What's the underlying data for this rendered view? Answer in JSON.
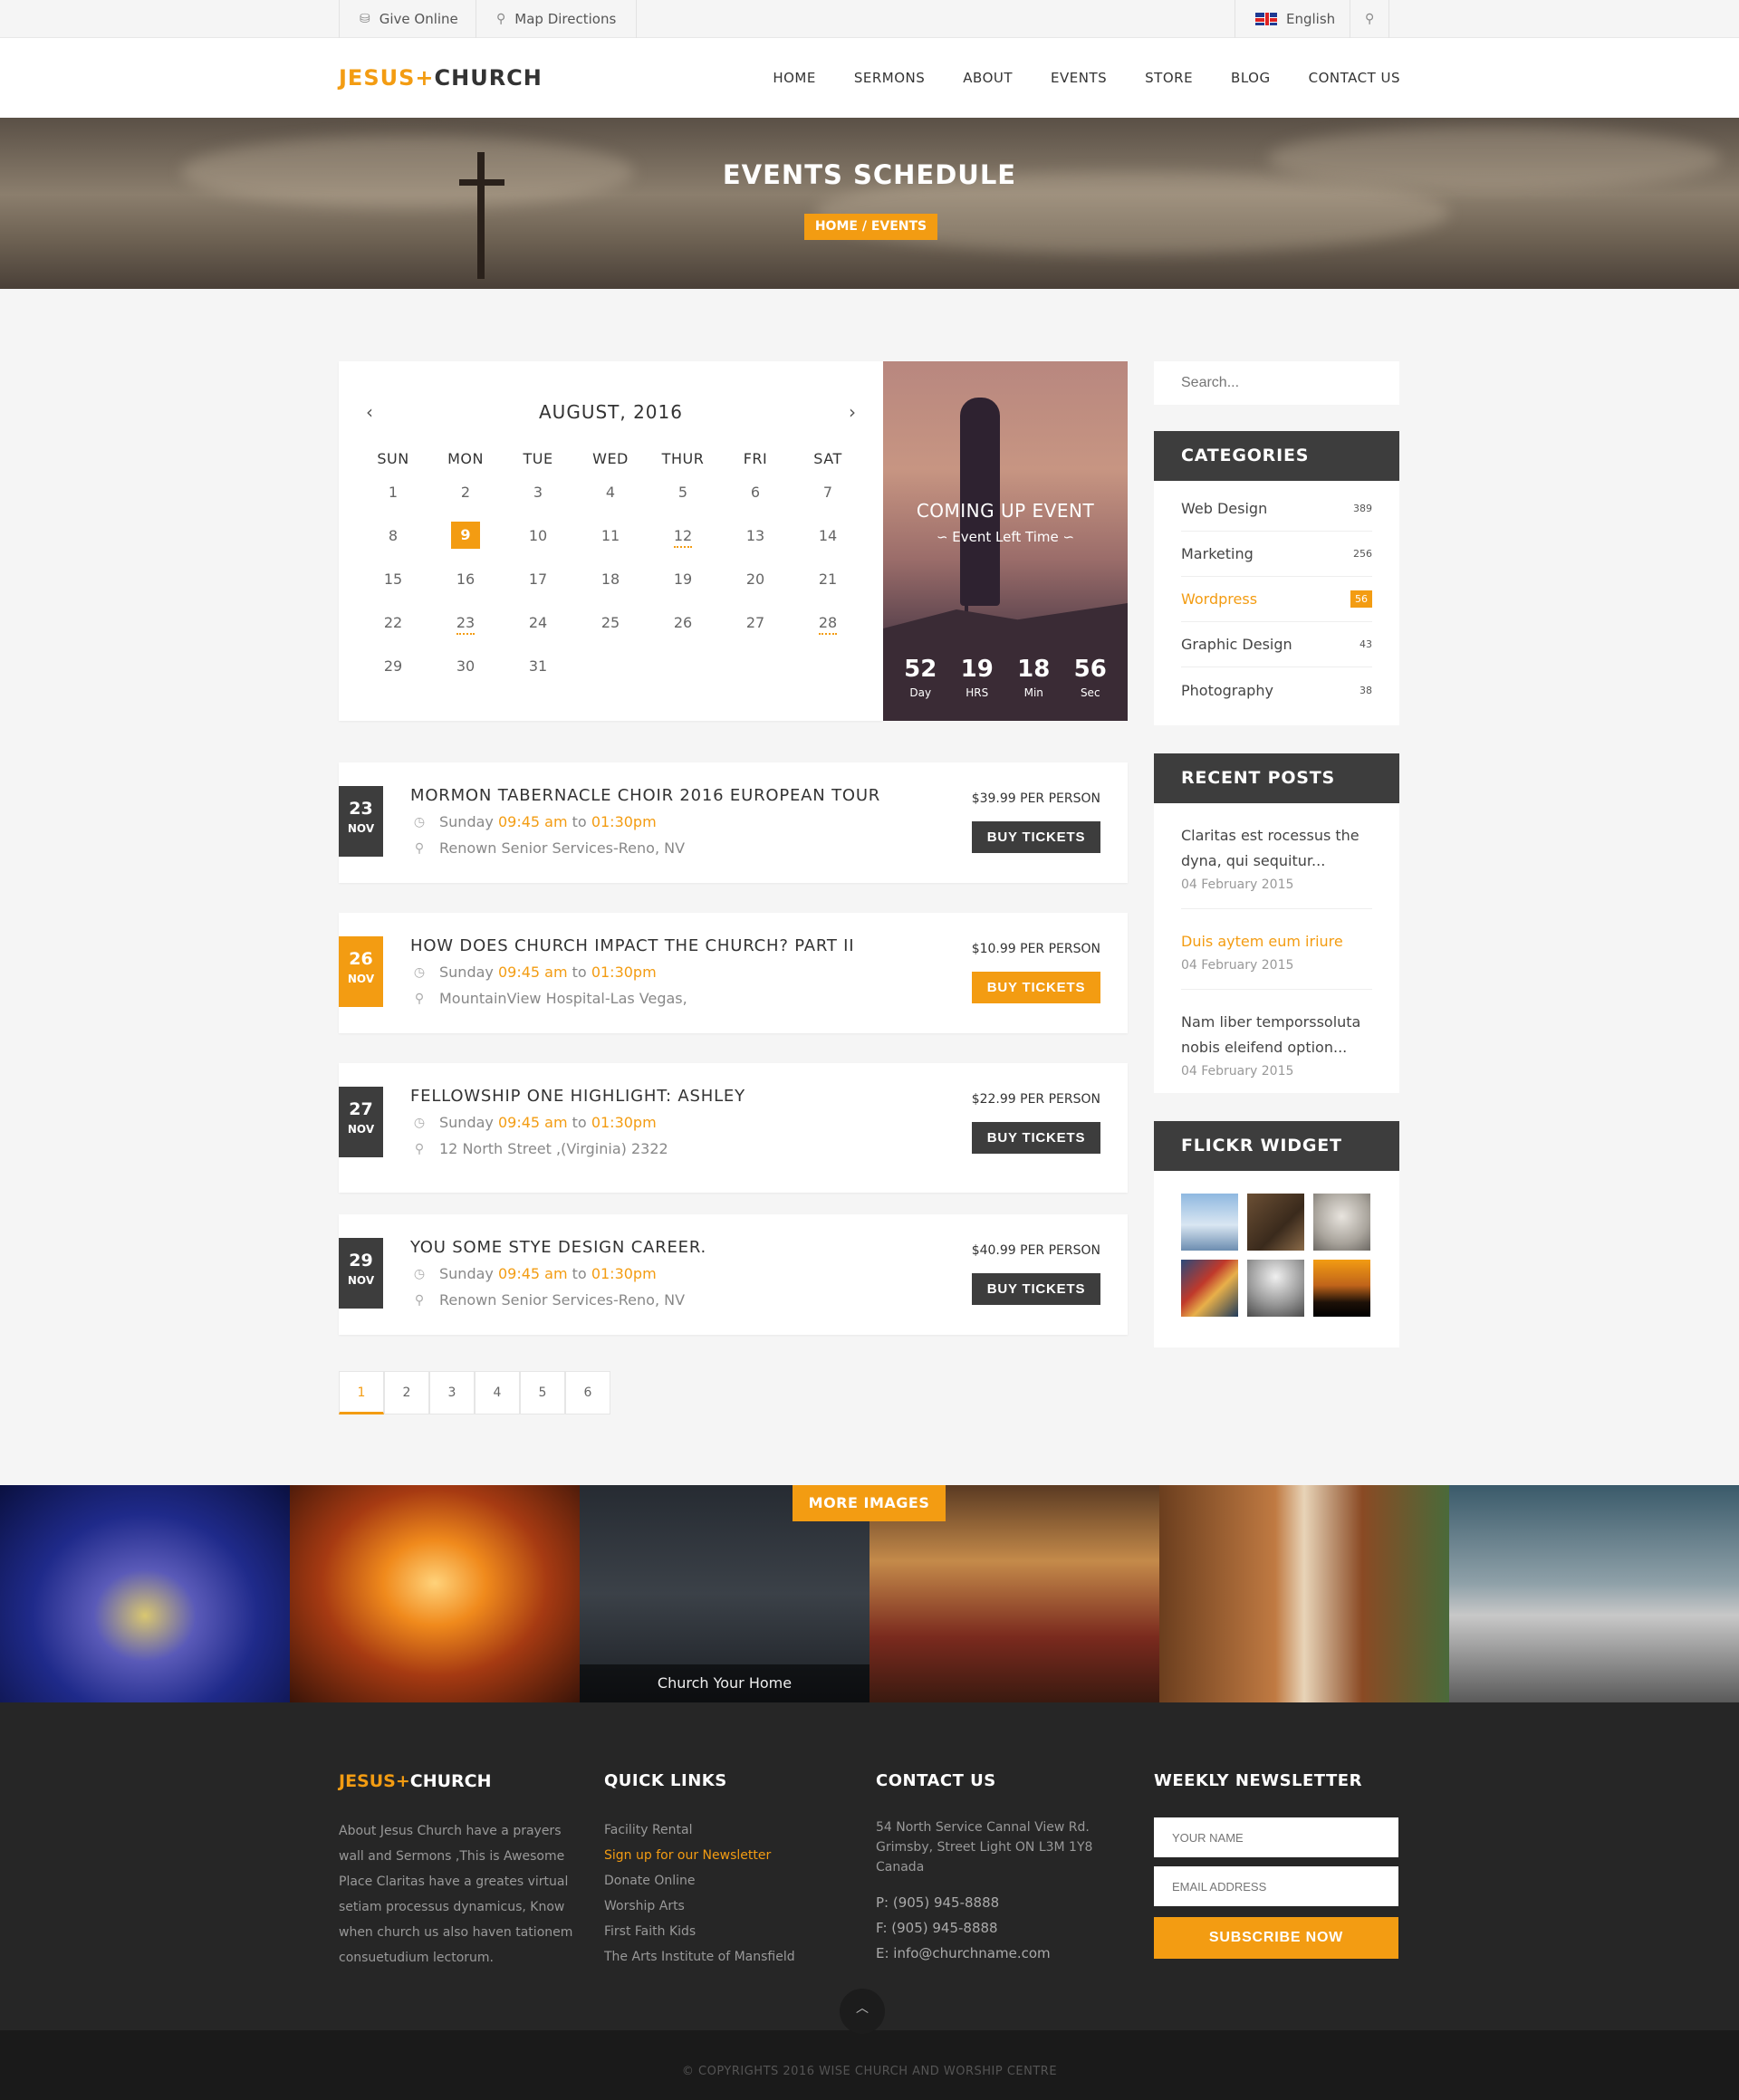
{
  "topbar": {
    "give_online": "Give Online",
    "map_directions": "Map Directions",
    "language": "English"
  },
  "brand": {
    "part1": "JESUS+",
    "part2": "CHURCH"
  },
  "nav": [
    "HOME",
    "SERMONS",
    "ABOUT",
    "EVENTS",
    "STORE",
    "BLOG",
    "CONTACT US"
  ],
  "hero": {
    "title": "EVENTS SCHEDULE",
    "breadcrumb": "HOME / EVENTS"
  },
  "calendar": {
    "month": "AUGUST, 2016",
    "days": [
      "SUN",
      "MON",
      "TUE",
      "WED",
      "THUR",
      "FRI",
      "SAT"
    ],
    "weeks": [
      [
        "1",
        "2",
        "3",
        "4",
        "5",
        "6",
        "7"
      ],
      [
        "8",
        "9",
        "10",
        "11",
        "12",
        "13",
        "14"
      ],
      [
        "15",
        "16",
        "17",
        "18",
        "19",
        "20",
        "21"
      ],
      [
        "22",
        "23",
        "24",
        "25",
        "26",
        "27",
        "28"
      ],
      [
        "29",
        "30",
        "31",
        "",
        "",
        "",
        ""
      ]
    ]
  },
  "upcoming": {
    "title": "COMING UP EVENT",
    "subtitle": "Event Left Time",
    "countdown": [
      {
        "value": "52",
        "label": "Day"
      },
      {
        "value": "19",
        "label": "HRS"
      },
      {
        "value": "18",
        "label": "Min"
      },
      {
        "value": "56",
        "label": "Sec"
      }
    ]
  },
  "events": [
    {
      "day": "23",
      "month": "NOV",
      "title": "MORMON TABERNACLE CHOIR 2016 EUROPEAN TOUR",
      "weekday": "Sunday",
      "start": "09:45 am",
      "to": "to",
      "end": "01:30pm",
      "location": "Renown Senior Services-Reno, NV",
      "price": "$39.99 PER PERSON",
      "button": "BUY TICKETS"
    },
    {
      "day": "26",
      "month": "NOV",
      "title": "HOW DOES CHURCH IMPACT THE CHURCH? PART II",
      "weekday": "Sunday",
      "start": "09:45 am",
      "to": "to",
      "end": "01:30pm",
      "location": "MountainView Hospital-Las Vegas,",
      "price": "$10.99 PER PERSON",
      "button": "BUY TICKETS"
    },
    {
      "day": "27",
      "month": "NOV",
      "title": "FELLOWSHIP ONE  HIGHLIGHT: ASHLEY",
      "weekday": "Sunday",
      "start": "09:45 am",
      "to": "to",
      "end": "01:30pm",
      "location": "12 North Street ,(Virginia) 2322",
      "price": "$22.99 PER PERSON",
      "button": "BUY TICKETS"
    },
    {
      "day": "29",
      "month": "NOV",
      "title": "YOU SOME STYE  DESIGN CAREER.",
      "weekday": "Sunday",
      "start": "09:45 am",
      "to": "to",
      "end": "01:30pm",
      "location": "Renown Senior Services-Reno, NV",
      "price": "$40.99 PER PERSON",
      "button": "BUY TICKETS"
    }
  ],
  "pagination": [
    "1",
    "2",
    "3",
    "4",
    "5",
    "6"
  ],
  "sidebar": {
    "search_placeholder": "Search...",
    "categories_title": "CATEGORIES",
    "categories": [
      {
        "name": "Web Design",
        "count": "389"
      },
      {
        "name": "Marketing",
        "count": "256"
      },
      {
        "name": "Wordpress",
        "count": "56"
      },
      {
        "name": "Graphic Design",
        "count": "43"
      },
      {
        "name": "Photography",
        "count": "38"
      }
    ],
    "recent_title": "RECENT POSTS",
    "recent_posts": [
      {
        "title": "Claritas est rocessus the dyna, qui sequitur...",
        "date": "04 February 2015"
      },
      {
        "title": "Duis aytem eum iriure",
        "date": "04 February 2015"
      },
      {
        "title": "Nam liber temporssoluta nobis eleifend option...",
        "date": "04 February 2015"
      }
    ],
    "flickr_title": "FLICKR WIDGET"
  },
  "gallery": {
    "more_button": "MORE IMAGES",
    "caption": "Church Your Home"
  },
  "footer": {
    "about_text": "About Jesus Church have a prayers wall and Sermons ,This is Awesome Place Claritas have a greates virtual setiam processus dynamicus, Know when church us also haven tationem consuetudium lectorum.",
    "quick_links_title": "QUICK LINKS",
    "quick_links": [
      "Facility Rental",
      "Sign up for our Newsletter",
      "Donate Online",
      "Worship Arts",
      "First Faith Kids",
      "The Arts Institute of Mansfield"
    ],
    "contact_title": "CONTACT US",
    "address": [
      "54 North Service Cannal View Rd.",
      "Grimsby, Street Light ON L3M 1Y8",
      "Canada"
    ],
    "phone": "P: (905) 945-8888",
    "fax": "F: (905) 945-8888",
    "email": "E: info@churchname.com",
    "newsletter_title": "WEEKLY NEWSLETTER",
    "name_placeholder": "YOUR NAME",
    "email_placeholder": "EMAIL ADDRESS",
    "subscribe": "SUBSCRIBE NOW",
    "copyright": "© COPYRIGHTS 2016 WISE CHURCH AND WORSHIP CENTRE"
  },
  "colors": {
    "accent": "#f39c12",
    "dark": "#3d3d3d"
  }
}
